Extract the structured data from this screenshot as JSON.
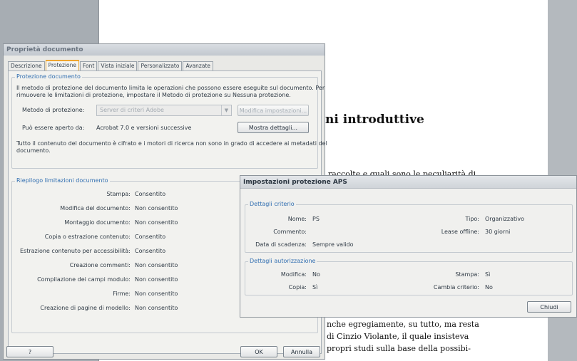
{
  "document": {
    "heading": "ni introduttive",
    "line_top": "raccolte e quali sono le peculiarità di",
    "lines": [
      "nche egregiamente, su tutto, ma resta",
      "di Cinzio Violante, il quale insisteva",
      "propri studi sulla base della possibi-"
    ]
  },
  "dialog": {
    "title": "Proprietà documento",
    "tabs": [
      "Descrizione",
      "Protezione",
      "Font",
      "Vista iniziale",
      "Personalizzato",
      "Avanzate"
    ],
    "active_tab": "Protezione",
    "protection_group": {
      "title": "Protezione documento",
      "intro_line1": "Il metodo di protezione del documento limita le operazioni che possono essere eseguite sul documento. Per",
      "intro_line2": "rimuovere le limitazioni di protezione, impostare il Metodo di protezione su Nessuna protezione.",
      "method_label": "Metodo di protezione:",
      "method_value": "Server di criteri Adobe",
      "modify_button": "Modifica impostazioni...",
      "open_label": "Può essere aperto da:",
      "open_value": "Acrobat 7.0 e versioni successive",
      "details_button": "Mostra dettagli...",
      "encrypt_line1": "Tutto il contenuto del documento è cifrato e i motori di ricerca non sono in grado di accedere ai metadati del",
      "encrypt_line2": "documento."
    },
    "restrictions_group": {
      "title": "Riepilogo limitazioni documento",
      "rows": [
        {
          "label": "Stampa:",
          "value": "Consentito"
        },
        {
          "label": "Modifica del documento:",
          "value": "Non consentito"
        },
        {
          "label": "Montaggio documento:",
          "value": "Non consentito"
        },
        {
          "label": "Copia o estrazione contenuto:",
          "value": "Consentito"
        },
        {
          "label": "Estrazione contenuto per accessibilità:",
          "value": "Consentito"
        },
        {
          "label": "Creazione commenti:",
          "value": "Non consentito"
        },
        {
          "label": "Compilazione dei campi modulo:",
          "value": "Non consentito"
        },
        {
          "label": "Firme:",
          "value": "Non consentito"
        },
        {
          "label": "Creazione di pagine di modello:",
          "value": "Non consentito"
        }
      ]
    },
    "help_button": "?",
    "ok_button": "OK",
    "cancel_button": "Annulla"
  },
  "aps_dialog": {
    "title": "Impostazioni protezione APS",
    "criteria_group": {
      "title": "Dettagli criterio",
      "name_label": "Nome:",
      "name_value": "PS",
      "type_label": "Tipo:",
      "type_value": "Organizzativo",
      "comment_label": "Commento:",
      "comment_value": "",
      "offline_label": "Lease offline:",
      "offline_value": "30 giorni",
      "expiry_label": "Data di scadenza:",
      "expiry_value": "Sempre valido"
    },
    "auth_group": {
      "title": "Dettagli autorizzazione",
      "modify_label": "Modifica:",
      "modify_value": "No",
      "print_label": "Stampa:",
      "print_value": "Sì",
      "copy_label": "Copia:",
      "copy_value": "Sì",
      "change_label": "Cambia criterio:",
      "change_value": "No"
    },
    "close_button": "Chiudi"
  }
}
